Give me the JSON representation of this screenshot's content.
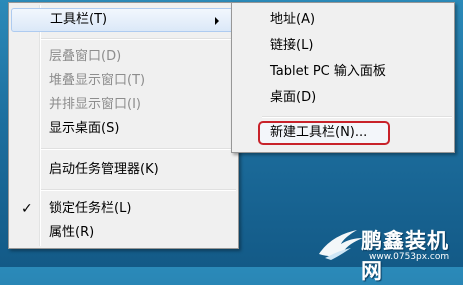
{
  "main_menu": {
    "toolbar": "工具栏(T)",
    "cascade": "层叠窗口(D)",
    "stacked": "堆叠显示窗口(T)",
    "side_by_side": "并排显示窗口(I)",
    "show_desktop": "显示桌面(S)",
    "task_manager": "启动任务管理器(K)",
    "lock_taskbar": "锁定任务栏(L)",
    "lock_taskbar_checked": true,
    "properties": "属性(R)"
  },
  "sub_menu": {
    "address": "地址(A)",
    "links": "链接(L)",
    "tablet_input": "Tablet PC 输入面板",
    "desktop": "桌面(D)",
    "new_toolbar": "新建工具栏(N)..."
  },
  "watermark": {
    "title": "鹏鑫装机网",
    "url": "www.0753px.com"
  },
  "colors": {
    "highlight_outline": "#c8222a",
    "menu_bg": "#f0f0f0",
    "desktop_bg": "#1d6f9f"
  }
}
